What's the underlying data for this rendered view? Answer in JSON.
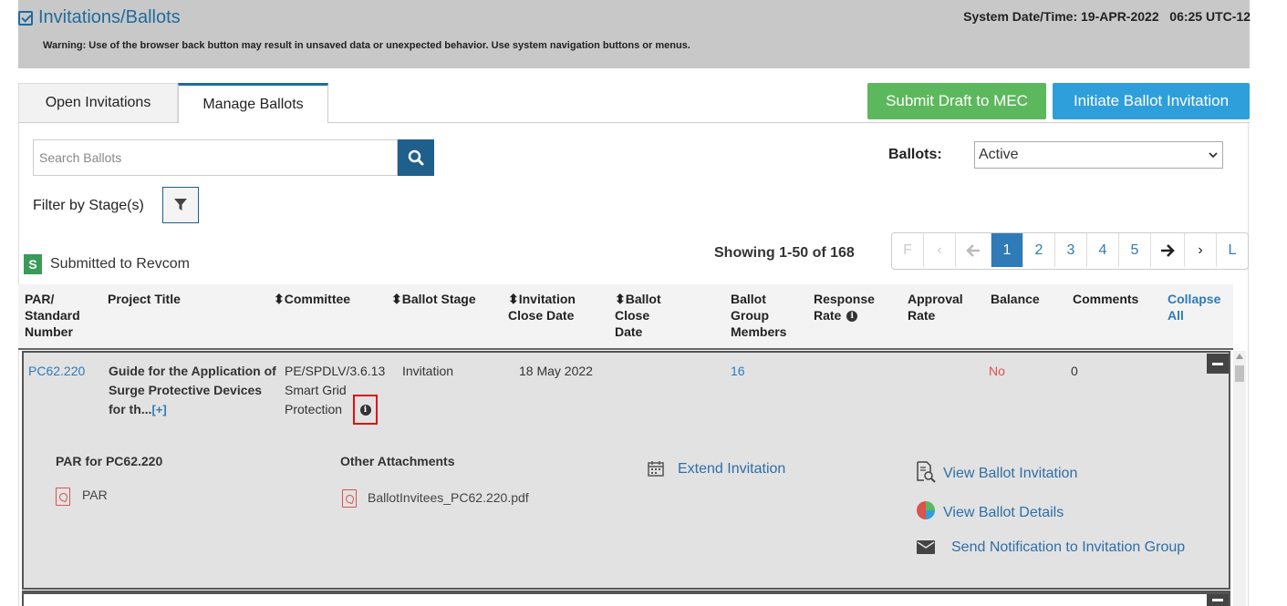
{
  "header": {
    "title": "Invitations/Ballots",
    "warning": "Warning: Use of the browser back button may result in unsaved data or unexpected behavior. Use system navigation buttons or menus.",
    "system_datetime": "System Date/Time: 19-APR-2022   06:25 UTC-12"
  },
  "tabs": [
    {
      "label": "Open Invitations",
      "active": false
    },
    {
      "label": "Manage Ballots",
      "active": true
    }
  ],
  "actions": {
    "submit_draft": "Submit Draft to MEC",
    "initiate_invitation": "Initiate Ballot Invitation"
  },
  "search": {
    "placeholder": "Search Ballots",
    "value": ""
  },
  "ballots_filter": {
    "label": "Ballots:",
    "selected": "Active"
  },
  "stage_filter": {
    "label": "Filter by Stage(s)"
  },
  "legend": {
    "badge": "S",
    "text": "Submitted to Revcom"
  },
  "pagination": {
    "showing": "Showing 1-50 of 168",
    "first": "F",
    "prev": "‹",
    "prev_arrow": "←",
    "pages": [
      "1",
      "2",
      "3",
      "4",
      "5"
    ],
    "current": "1",
    "next_arrow": "→",
    "next": "›",
    "last": "L"
  },
  "table": {
    "columns": {
      "par": "PAR/ Standard Number",
      "project_title": "Project Title",
      "committee": "⬍Committee",
      "ballot_stage": "⬍Ballot Stage",
      "invitation_close": "⬍Invitation Close Date",
      "ballot_close": "⬍Ballot Close Date",
      "group_members": "Ballot Group Members",
      "response_rate": "Response Rate",
      "approval_rate": "Approval Rate",
      "balance": "Balance",
      "comments": "Comments",
      "collapse_all": "Collapse All"
    },
    "row": {
      "par": "PC62.220",
      "project_title": "Guide for the Application of Surge Protective Devices for th...",
      "expand": "[+]",
      "committee": "PE/SPDLV/3.6.13 Smart Grid Protection",
      "ballot_stage": "Invitation",
      "invitation_close": "18 May 2022",
      "ballot_close": "",
      "group_members": "16",
      "response_rate": "",
      "approval_rate": "",
      "balance": "No",
      "comments": "0"
    },
    "details": {
      "par_heading": "PAR for PC62.220",
      "par_file": "PAR",
      "attachments_heading": "Other Attachments",
      "attachment_file": "BallotInvitees_PC62.220.pdf",
      "extend_invitation": "Extend Invitation",
      "view_invitation": "View Ballot Invitation",
      "view_details": "View Ballot Details",
      "send_notification": "Send Notification to Invitation Group"
    }
  }
}
